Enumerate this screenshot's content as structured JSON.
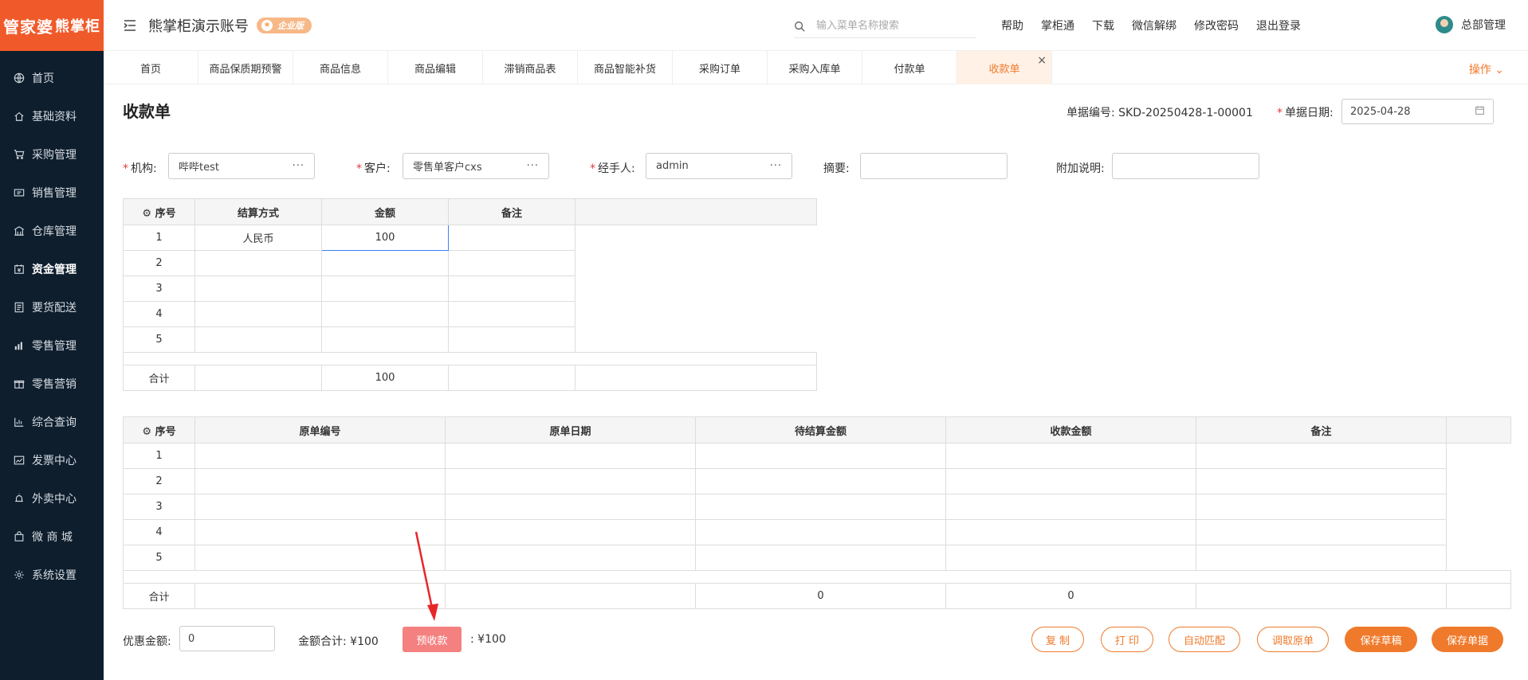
{
  "sidebar": {
    "logo_main": "管家婆",
    "logo_sub": "熊掌柜",
    "items": [
      {
        "label": "首页",
        "icon": "globe-icon"
      },
      {
        "label": "基础资料",
        "icon": "home-icon"
      },
      {
        "label": "采购管理",
        "icon": "cart-icon"
      },
      {
        "label": "销售管理",
        "icon": "ticket-icon"
      },
      {
        "label": "仓库管理",
        "icon": "warehouse-icon"
      },
      {
        "label": "资金管理",
        "icon": "calendar-money-icon"
      },
      {
        "label": "要货配送",
        "icon": "list-icon"
      },
      {
        "label": "零售管理",
        "icon": "bar-chart-icon"
      },
      {
        "label": "零售营销",
        "icon": "gift-icon"
      },
      {
        "label": "综合查询",
        "icon": "chart-icon"
      },
      {
        "label": "发票中心",
        "icon": "line-chart-icon"
      },
      {
        "label": "外卖中心",
        "icon": "alarm-icon"
      },
      {
        "label": "微 商 城",
        "icon": "bag-icon"
      },
      {
        "label": "系统设置",
        "icon": "gear-icon"
      }
    ]
  },
  "header": {
    "account_title": "熊掌柜演示账号",
    "badge": "企业版",
    "search_placeholder": "输入菜单名称搜索",
    "links": [
      "帮助",
      "掌柜通",
      "下载",
      "微信解绑",
      "修改密码",
      "退出登录"
    ],
    "user": "总部管理"
  },
  "tabs": [
    "首页",
    "商品保质期预警",
    "商品信息",
    "商品编辑",
    "滞销商品表",
    "商品智能补货",
    "采购订单",
    "采购入库单",
    "付款单",
    "收款单"
  ],
  "ops_label": "操作",
  "form": {
    "title": "收款单",
    "doc_no_label": "单据编号:",
    "doc_no": "SKD-20250428-1-00001",
    "doc_date_label": "单据日期:",
    "doc_date": "2025-04-28",
    "org_label": "机构:",
    "org_value": "哔哔test",
    "customer_label": "客户:",
    "customer_value": "零售单客户cxs",
    "handler_label": "经手人:",
    "handler_value": "admin",
    "summary_label": "摘要:",
    "note_label": "附加说明:"
  },
  "table1": {
    "headers": [
      "序号",
      "结算方式",
      "金额",
      "备注"
    ],
    "rows": [
      [
        "1",
        "人民币",
        "100",
        ""
      ],
      [
        "2",
        "",
        "",
        ""
      ],
      [
        "3",
        "",
        "",
        ""
      ],
      [
        "4",
        "",
        "",
        ""
      ],
      [
        "5",
        "",
        "",
        ""
      ]
    ],
    "total_label": "合计",
    "total_amount": "100"
  },
  "table2": {
    "headers": [
      "序号",
      "原单编号",
      "原单日期",
      "待结算金额",
      "收款金额",
      "备注"
    ],
    "rows": [
      [
        "1"
      ],
      [
        "2"
      ],
      [
        "3"
      ],
      [
        "4"
      ],
      [
        "5"
      ]
    ],
    "total_label": "合计",
    "total_pending": "0",
    "total_received": "0"
  },
  "footer": {
    "discount_label": "优惠金额:",
    "discount_value": "0",
    "amount_total": "金额合计: ¥100",
    "pre_button": "预收款",
    "pre_value": ": ¥100",
    "buttons": [
      "复 制",
      "打 印",
      "自动匹配",
      "调取原单",
      "保存草稿",
      "保存单据"
    ]
  },
  "colors": {
    "accent": "#f07a2b",
    "sidebar": "#0e1e2d",
    "logo": "#f05a2a",
    "pre_button": "#f58080",
    "annotation_arrow": "#e8262a"
  }
}
